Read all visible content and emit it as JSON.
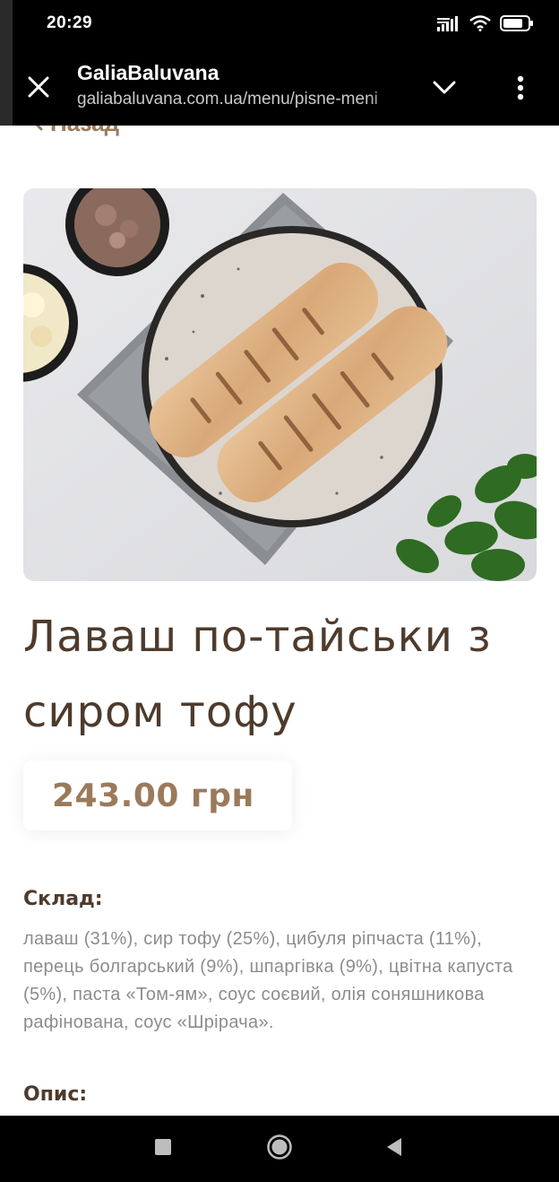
{
  "status_bar": {
    "time": "20:29",
    "icons": [
      "signal-icon",
      "wifi-icon",
      "battery-icon"
    ]
  },
  "toolbar": {
    "close_icon": "close-icon",
    "site_title": "GaliaBaluvana",
    "url": "galiabaluvana.com.ua/menu/pisne-meni",
    "dropdown_icon": "chevron-down-icon",
    "menu_icon": "more-vertical-icon"
  },
  "page": {
    "back_label": "Назад",
    "image_alt": "lavash-photo",
    "title": "Лаваш по-тайськи з сиром тофу",
    "price": "243.00 грн",
    "composition_label": "Склад:",
    "composition_text": "лаваш (31%), сир тофу (25%), цибуля ріпчаста (11%), перець болгарський (9%), шпаргівка (9%), цвітна капуста (5%), паста «Том-ям», соус соєвий, олія соняшникова рафінована, соус «Шрірача».",
    "description_label": "Опис:"
  },
  "colors": {
    "accent": "#9b7a5b",
    "title": "#4e3b2c",
    "body_text": "#8c8c8c"
  },
  "nav_bar": {
    "icons": [
      "recent-apps-icon",
      "home-icon",
      "back-icon"
    ]
  }
}
